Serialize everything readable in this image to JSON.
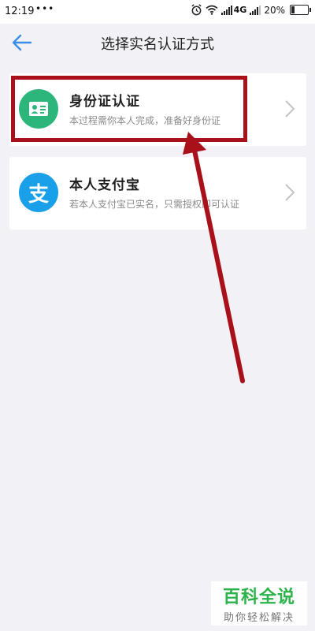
{
  "status_bar": {
    "time": "12:19",
    "dots": "•••",
    "network": "4G",
    "battery_text": "20%",
    "battery_level": 0.2
  },
  "nav": {
    "title": "选择实名认证方式",
    "back_icon": "back-arrow-icon",
    "accent_color": "#3a8ee6"
  },
  "methods": [
    {
      "title": "身份证认证",
      "subtitle": "本过程需你本人完成，准备好身份证",
      "icon": "id-card-icon",
      "icon_color": "#2db67c"
    },
    {
      "title": "本人支付宝",
      "subtitle": "若本人支付宝已实名，只需授权即可认证",
      "icon": "alipay-icon",
      "icon_glyph": "支",
      "icon_color": "#1aa0e8"
    }
  ],
  "annotation": {
    "color": "#a8101a"
  },
  "watermark": {
    "title": "百科全说",
    "subtitle": "助你轻松解决"
  }
}
